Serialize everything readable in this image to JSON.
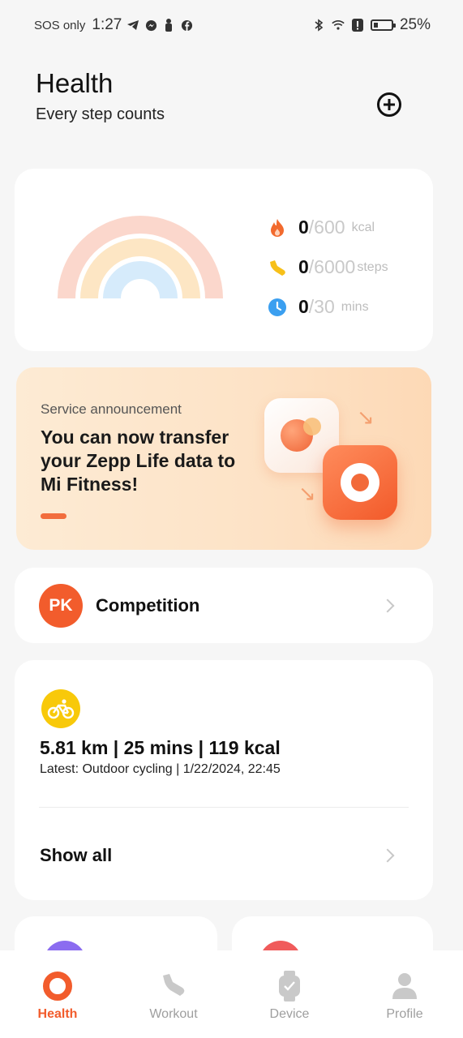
{
  "status_bar": {
    "carrier": "SOS only",
    "time": "1:27",
    "battery": "25%",
    "battery_level": 0.25,
    "notification_icons": [
      "telegram-icon",
      "messenger-icon",
      "notification-icon",
      "facebook-icon"
    ],
    "system_icons": [
      "bluetooth-icon",
      "wifi-icon",
      "alert-icon",
      "battery-icon"
    ]
  },
  "header": {
    "title": "Health",
    "subtitle": "Every step counts",
    "add_icon": "plus-circle-icon"
  },
  "activity": {
    "calories": {
      "value": "0",
      "goal": "/600",
      "unit": "kcal",
      "icon": "flame-icon",
      "color": "#f26a2e",
      "ring_color": "#fbd7cc"
    },
    "steps": {
      "value": "0",
      "goal": "/6000",
      "unit": "steps",
      "icon": "shoe-icon",
      "color": "#f7c019",
      "ring_color": "#fde6c4"
    },
    "minutes": {
      "value": "0",
      "goal": "/30",
      "unit": "mins",
      "icon": "clock-icon",
      "color": "#3b9ff0",
      "ring_color": "#d6ebfb"
    }
  },
  "banner": {
    "tag": "Service announcement",
    "message": "You can now transfer your Zepp Life data to Mi Fitness!",
    "accent": "#f26d3d"
  },
  "competition": {
    "badge": "PK",
    "title": "Competition"
  },
  "workout": {
    "icon": "bicycle-icon",
    "summary": "5.81 km | 25 mins  | 119 kcal",
    "latest": "Latest: Outdoor cycling | 1/22/2024, 22:45",
    "show_all": "Show all"
  },
  "nav": {
    "items": [
      {
        "label": "Health",
        "icon": "health-ring-icon",
        "active": true
      },
      {
        "label": "Workout",
        "icon": "shoe-icon",
        "active": false
      },
      {
        "label": "Device",
        "icon": "watch-icon",
        "active": false
      },
      {
        "label": "Profile",
        "icon": "person-icon",
        "active": false
      }
    ],
    "active_color": "#f25c2c"
  }
}
